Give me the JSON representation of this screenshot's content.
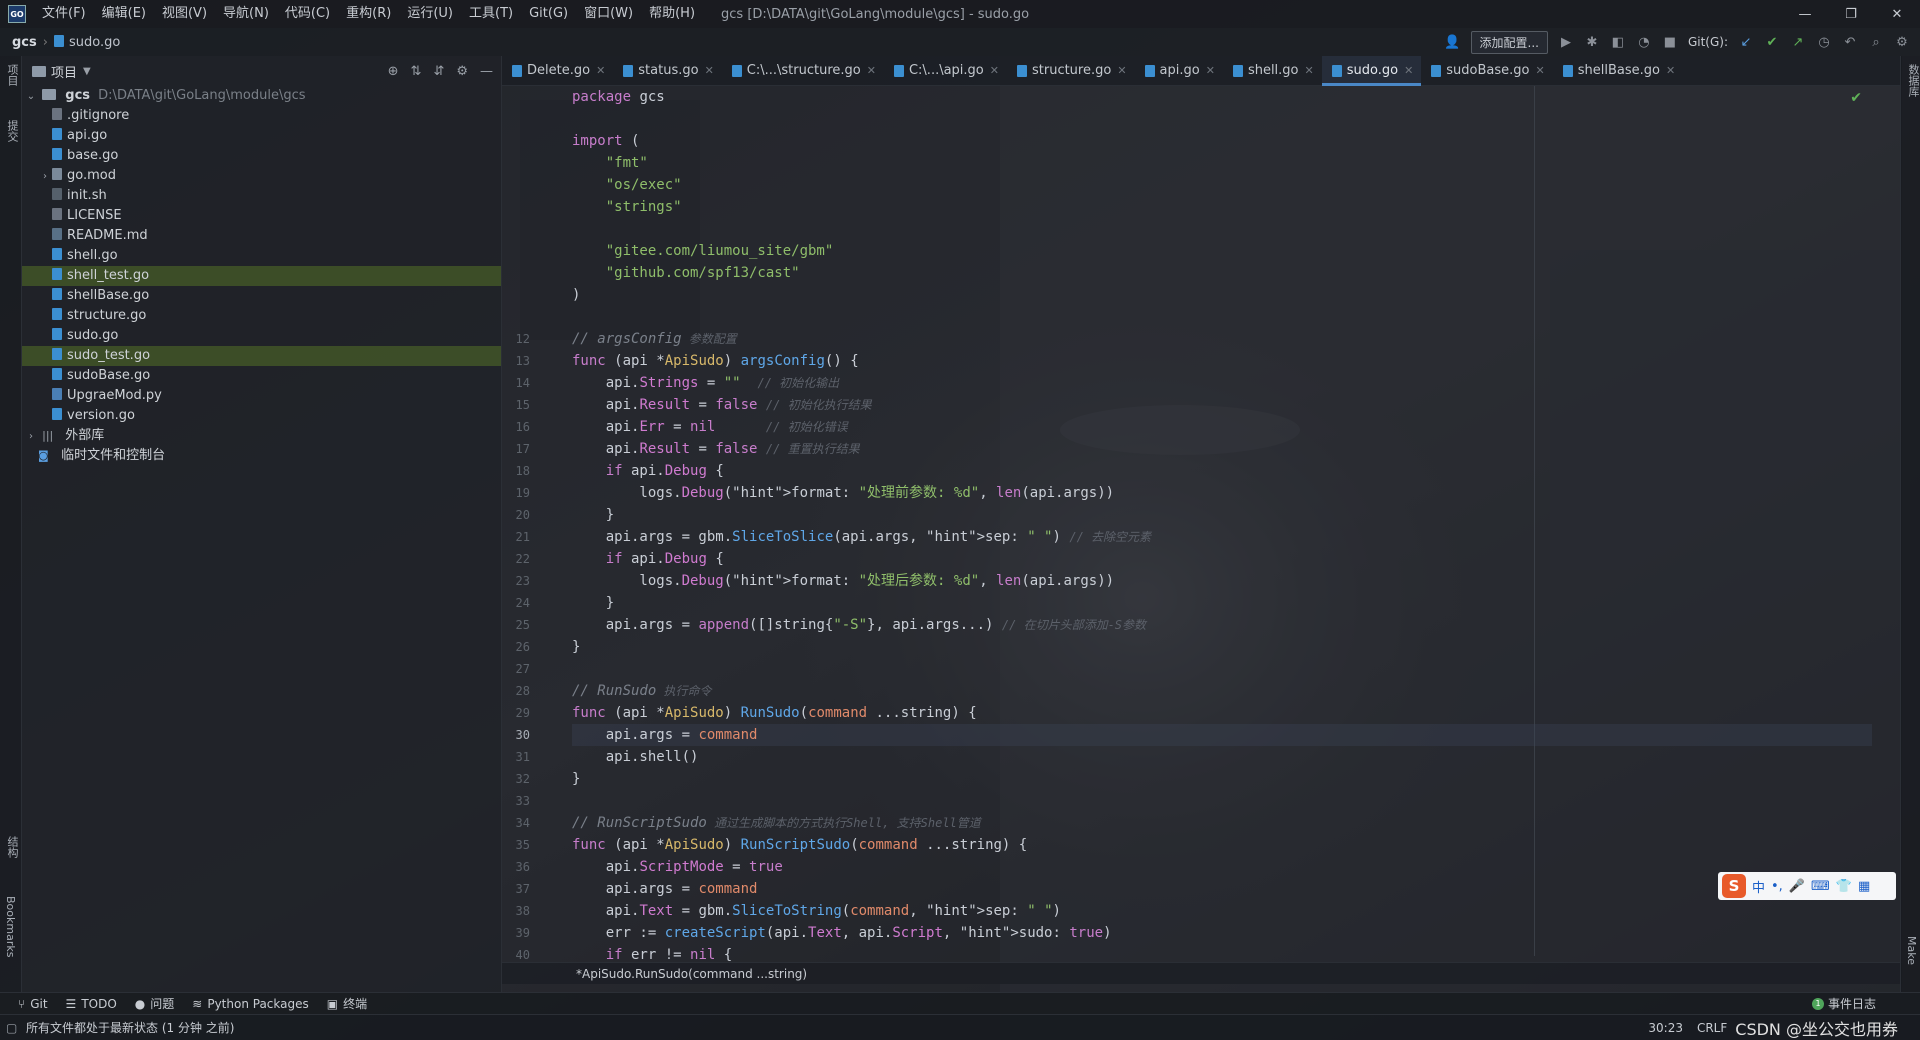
{
  "menu": {
    "items": [
      "文件(F)",
      "编辑(E)",
      "视图(V)",
      "导航(N)",
      "代码(C)",
      "重构(R)",
      "运行(U)",
      "工具(T)",
      "Git(G)",
      "窗口(W)",
      "帮助(H)"
    ],
    "window_title": "gcs [D:\\DATA\\git\\GoLang\\module\\gcs] - sudo.go",
    "logo": "GO"
  },
  "navbar": {
    "project": "gcs",
    "file": "sudo.go",
    "add_config": "添加配置...",
    "git_label": "Git(G):"
  },
  "left_stripe": {
    "project": "项目",
    "commit": "提交",
    "structure": "结构",
    "bookmarks": "Bookmarks"
  },
  "right_stripe": {
    "database": "数据库",
    "make": "Make"
  },
  "project_panel": {
    "title": "项目",
    "root": {
      "name": "gcs",
      "path": "D:\\DATA\\git\\GoLang\\module\\gcs"
    },
    "files": [
      {
        "name": ".gitignore",
        "type": "txt",
        "highlight": false
      },
      {
        "name": "api.go",
        "type": "go",
        "highlight": false
      },
      {
        "name": "base.go",
        "type": "go",
        "highlight": false
      },
      {
        "name": "go.mod",
        "type": "mod",
        "highlight": false,
        "expandable": true
      },
      {
        "name": "init.sh",
        "type": "sh",
        "highlight": false
      },
      {
        "name": "LICENSE",
        "type": "txt",
        "highlight": false
      },
      {
        "name": "README.md",
        "type": "md",
        "highlight": false
      },
      {
        "name": "shell.go",
        "type": "go",
        "highlight": false
      },
      {
        "name": "shell_test.go",
        "type": "go",
        "highlight": true
      },
      {
        "name": "shellBase.go",
        "type": "go",
        "highlight": false
      },
      {
        "name": "structure.go",
        "type": "go",
        "highlight": false
      },
      {
        "name": "sudo.go",
        "type": "go",
        "highlight": false
      },
      {
        "name": "sudo_test.go",
        "type": "go",
        "highlight": true
      },
      {
        "name": "sudoBase.go",
        "type": "go",
        "highlight": false
      },
      {
        "name": "UpgraeMod.py",
        "type": "py",
        "highlight": false
      },
      {
        "name": "version.go",
        "type": "go",
        "highlight": false
      }
    ],
    "external_libs": "外部库",
    "scratches": "临时文件和控制台"
  },
  "tabs": [
    {
      "label": "Delete.go",
      "active": false
    },
    {
      "label": "status.go",
      "active": false
    },
    {
      "label": "C:\\...\\structure.go",
      "active": false
    },
    {
      "label": "C:\\...\\api.go",
      "active": false
    },
    {
      "label": "structure.go",
      "active": false
    },
    {
      "label": "api.go",
      "active": false
    },
    {
      "label": "shell.go",
      "active": false
    },
    {
      "label": "sudo.go",
      "active": true
    },
    {
      "label": "sudoBase.go",
      "active": false
    },
    {
      "label": "shellBase.go",
      "active": false
    }
  ],
  "editor": {
    "line_numbers": [
      "",
      "",
      "",
      "",
      "",
      "",
      "",
      "",
      "",
      "",
      "",
      "12",
      "13",
      "14",
      "15",
      "16",
      "17",
      "18",
      "19",
      "20",
      "21",
      "22",
      "23",
      "24",
      "25",
      "26",
      "27",
      "28",
      "29",
      "30",
      "31",
      "32",
      "33",
      "34",
      "35",
      "36",
      "37",
      "38",
      "39",
      "40"
    ],
    "current_line": "30",
    "code_lines": [
      "package gcs",
      "",
      "import (",
      "    \"fmt\"",
      "    \"os/exec\"",
      "    \"strings\"",
      "",
      "    \"gitee.com/liumou_site/gbm\"",
      "    \"github.com/spf13/cast\"",
      ")",
      "",
      "// argsConfig 参数配置",
      "func (api *ApiSudo) argsConfig() {",
      "    api.Strings = \"\"  // 初始化输出",
      "    api.Result = false // 初始化执行结果",
      "    api.Err = nil      // 初始化错误",
      "    api.Result = false // 重置执行结果",
      "    if api.Debug {",
      "        logs.Debug(format: \"处理前参数: %d\", len(api.args))",
      "    }",
      "    api.args = gbm.SliceToSlice(api.args, sep: \" \") // 去除空元素",
      "    if api.Debug {",
      "        logs.Debug(format: \"处理后参数: %d\", len(api.args))",
      "    }",
      "    api.args = append([]string{\"-S\"}, api.args...) // 在切片头部添加-S参数",
      "}",
      "",
      "// RunSudo 执行命令",
      "func (api *ApiSudo) RunSudo(command ...string) {",
      "    api.args = command",
      "    api.shell()",
      "}",
      "",
      "// RunScriptSudo 通过生成脚本的方式执行Shell, 支持Shell管道",
      "func (api *ApiSudo) RunScriptSudo(command ...string) {",
      "    api.ScriptMode = true",
      "    api.args = command",
      "    api.Text = gbm.SliceToString(command, sep: \" \")",
      "    err := createScript(api.Text, api.Script, sudo: true)",
      "    if err != nil {"
    ],
    "breadcrumb": "*ApiSudo.RunSudo(command ...string)"
  },
  "bottom_tools": {
    "git": "Git",
    "todo": "TODO",
    "problems": "问题",
    "python_packages": "Python Packages",
    "terminal": "终端",
    "event_log": "事件日志",
    "event_count": "1"
  },
  "status": {
    "message": "所有文件都处于最新状态 (1 分钟 之前)",
    "cursor": "30:23",
    "line_sep": "CRLF",
    "watermark": "CSDN @坐公交也用券"
  },
  "ime": {
    "logo": "S",
    "mode": "中"
  }
}
